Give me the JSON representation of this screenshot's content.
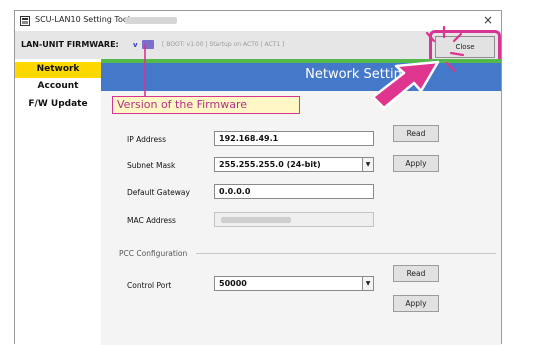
{
  "window": {
    "title": "SCU-LAN10 Setting Tool -",
    "close_glyph": "×"
  },
  "firmware_bar": {
    "label": "LAN-UNIT FIRMWARE:",
    "version_prefix": "v",
    "extra_info": "[ BOOT: v1.00 | Startup on ACT0 | ACT1 ]",
    "close_button": "Close"
  },
  "sidebar": {
    "items": [
      {
        "label": "Network",
        "active": true
      },
      {
        "label": "Account",
        "active": false
      },
      {
        "label": "F/W Update",
        "active": false
      }
    ]
  },
  "header": {
    "title": "Network Settings"
  },
  "network": {
    "ip_label": "IP Address",
    "ip_value": "192.168.49.1",
    "subnet_label": "Subnet Mask",
    "subnet_value": "255.255.255.0 (24-bit)",
    "gateway_label": "Default Gateway",
    "gateway_value": "0.0.0.0",
    "mac_label": "MAC Address",
    "read_button": "Read",
    "apply_button": "Apply"
  },
  "pcc": {
    "section_title": "PCC Configuration",
    "port_label": "Control Port",
    "port_value": "50000",
    "read_button": "Read",
    "apply_button": "Apply"
  },
  "annotation": {
    "callout_text": "Version of the Firmware",
    "color": "#d63691"
  },
  "colors": {
    "header_blue": "#4478c8",
    "header_green": "#53b94a",
    "nav_active": "#ffd800",
    "accent_magenta": "#d63691"
  }
}
